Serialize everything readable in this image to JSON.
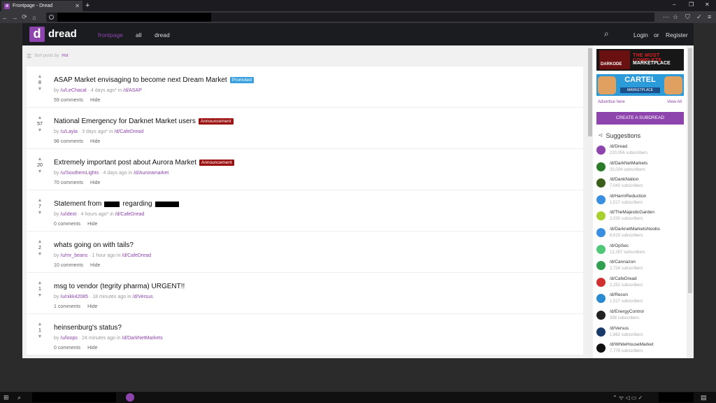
{
  "browser": {
    "tab_title": "Frontpage - Dread",
    "tab_favicon": "d",
    "close_glyph": "✕",
    "newtab_glyph": "+",
    "window_controls": [
      "–",
      "❐",
      "✕"
    ],
    "nav_icons": [
      "←",
      "→",
      "⟳",
      "⌂"
    ],
    "right_icons": [
      "⋯",
      "☆",
      "⛉",
      "✓",
      "≡"
    ]
  },
  "site": {
    "logo_letter": "d",
    "logo_text": "dread",
    "nav": {
      "frontpage": "frontpage",
      "all": "all",
      "dread": "dread"
    },
    "search_icon": "⌕",
    "login": "Login",
    "or": "or",
    "register": "Register",
    "accent_color": "#8e44ad"
  },
  "sort": {
    "prefix": "Sort posts by",
    "value": "Hot"
  },
  "posts": [
    {
      "score": "8",
      "title": "ASAP Market envisaging to become next Dream Market",
      "badge": "Promoted",
      "by": "by",
      "user": "/u/LeChacal",
      "time": "· 4 days ago* in",
      "sub": "/d/ASAP",
      "comments": "59 comments",
      "hide": "Hide"
    },
    {
      "score": "57",
      "title": "National Emergency for Darknet Market users",
      "badge": "Announcement",
      "by": "by",
      "user": "/u/Layla",
      "time": "· 3 days ago* in",
      "sub": "/d/CafeDread",
      "comments": "98 comments",
      "hide": "Hide"
    },
    {
      "score": "20",
      "title": "Extremely important post about Aurora Market",
      "badge": "Announcement",
      "by": "by",
      "user": "/u/SouthernLights",
      "time": "· 4 days ago in",
      "sub": "/d/Auroramarket",
      "comments": "70 comments",
      "hide": "Hide"
    },
    {
      "score": "7",
      "title_a": "Statement from",
      "title_b": "regarding",
      "by": "by",
      "user": "/u/ideot",
      "time": "· 4 hours ago* in",
      "sub": "/d/CafeDread",
      "comments": "0 comments",
      "hide": "Hide"
    },
    {
      "score": "2",
      "title": "whats going on with tails?",
      "by": "by",
      "user": "/u/mr_beans",
      "time": "· 1 hour ago in",
      "sub": "/d/CafeDread",
      "comments": "10 comments",
      "hide": "Hide"
    },
    {
      "score": "1",
      "title": "msg to vendor (tegrity pharma) URGENT!!",
      "by": "by",
      "user": "/u/nikk42085",
      "time": "· 18 minutes ago in",
      "sub": "/d/Versus",
      "comments": "1 comments",
      "hide": "Hide"
    },
    {
      "score": "1",
      "title": "heinsenburg's status?",
      "by": "by",
      "user": "/u/loops",
      "time": "· 24 minutes ago in",
      "sub": "/d/DarkNetMarkets",
      "comments": "0 comments",
      "hide": "Hide"
    }
  ],
  "vote": {
    "up": "▲",
    "down": "▼"
  },
  "sidebar": {
    "ad1": {
      "brand": "DARKODE",
      "line1": "THE MOST COMPLETE",
      "line2": "MARKETPLACE"
    },
    "ad2": {
      "brand": "CARTEL",
      "tag": "MARKETPLACE"
    },
    "advertise": "Advertise here",
    "view_all": "View All",
    "create": "CREATE A SUBDREAD",
    "suggestions": "Suggestions",
    "subs": [
      {
        "name": "/d/Dread",
        "count": "220,056 subscribers",
        "color": "#8e44ad"
      },
      {
        "name": "/d/DarkNetMarkets",
        "count": "33,034 subscribers",
        "color": "#2a7a2a"
      },
      {
        "name": "/d/DankNation",
        "count": "7,043 subscribers",
        "color": "#3b5e1a"
      },
      {
        "name": "/d/HarmReduction",
        "count": "1,517 subscribers",
        "color": "#3a8ee0"
      },
      {
        "name": "/d/TheMajesticGarden",
        "count": "2,030 subscribers",
        "color": "#a8d030"
      },
      {
        "name": "/d/DarknetMarketsNoobs",
        "count": "8,615 subscribers",
        "color": "#3a8ee0"
      },
      {
        "name": "/d/OpSec",
        "count": "12,287 subscribers",
        "color": "#50c878"
      },
      {
        "name": "/d/Cannazon",
        "count": "2,724 subscribers",
        "color": "#30a050"
      },
      {
        "name": "/d/CafeDread",
        "count": "2,252 subscribers",
        "color": "#d03030"
      },
      {
        "name": "/d/Recon",
        "count": "1,517 subscribers",
        "color": "#2a8ad0"
      },
      {
        "name": "/d/EnergyControl",
        "count": "398 subscribers",
        "color": "#222222"
      },
      {
        "name": "/d/Versus",
        "count": "1,862 subscribers",
        "color": "#1a3a6a"
      },
      {
        "name": "/d/WhiteHouseMarket",
        "count": "7,778 subscribers",
        "color": "#111111"
      }
    ]
  },
  "taskbar": {
    "start": "⊞",
    "search": "⌕",
    "tray": "⌃ ᯤ ◁ ▭ ✓",
    "notif": "▤"
  }
}
